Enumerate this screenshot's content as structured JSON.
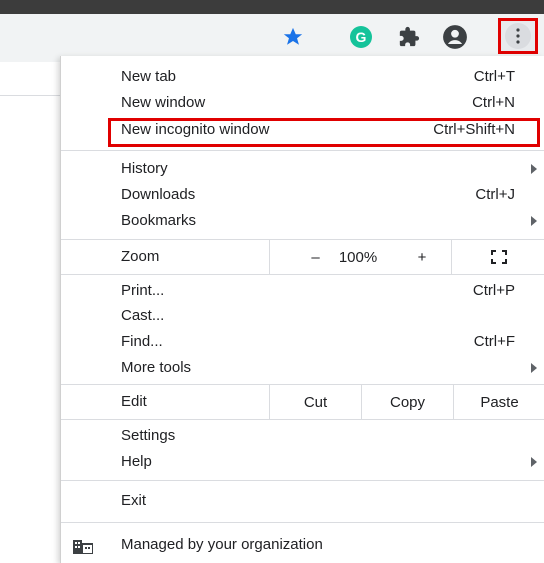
{
  "colors": {
    "highlight": "#e00000",
    "star": "#1a73e8",
    "grammarly": "#15c39a"
  },
  "toolbar": {
    "bookmark_icon": "star-icon",
    "grammarly_letter": "G",
    "extensions_icon": "puzzle-icon",
    "account_icon": "account-icon",
    "menu_icon": "kebab-icon"
  },
  "menu": {
    "new_tab": {
      "label": "New tab",
      "shortcut": "Ctrl+T"
    },
    "new_window": {
      "label": "New window",
      "shortcut": "Ctrl+N"
    },
    "new_incognito": {
      "label": "New incognito window",
      "shortcut": "Ctrl+Shift+N"
    },
    "history": {
      "label": "History"
    },
    "downloads": {
      "label": "Downloads",
      "shortcut": "Ctrl+J"
    },
    "bookmarks": {
      "label": "Bookmarks"
    },
    "zoom": {
      "label": "Zoom",
      "minus": "–",
      "level": "100%",
      "plus": "+"
    },
    "print": {
      "label": "Print...",
      "shortcut": "Ctrl+P"
    },
    "cast": {
      "label": "Cast..."
    },
    "find": {
      "label": "Find...",
      "shortcut": "Ctrl+F"
    },
    "more_tools": {
      "label": "More tools"
    },
    "edit": {
      "label": "Edit",
      "cut": "Cut",
      "copy": "Copy",
      "paste": "Paste"
    },
    "settings": {
      "label": "Settings"
    },
    "help": {
      "label": "Help"
    },
    "exit": {
      "label": "Exit"
    },
    "managed": {
      "label": "Managed by your organization"
    }
  }
}
